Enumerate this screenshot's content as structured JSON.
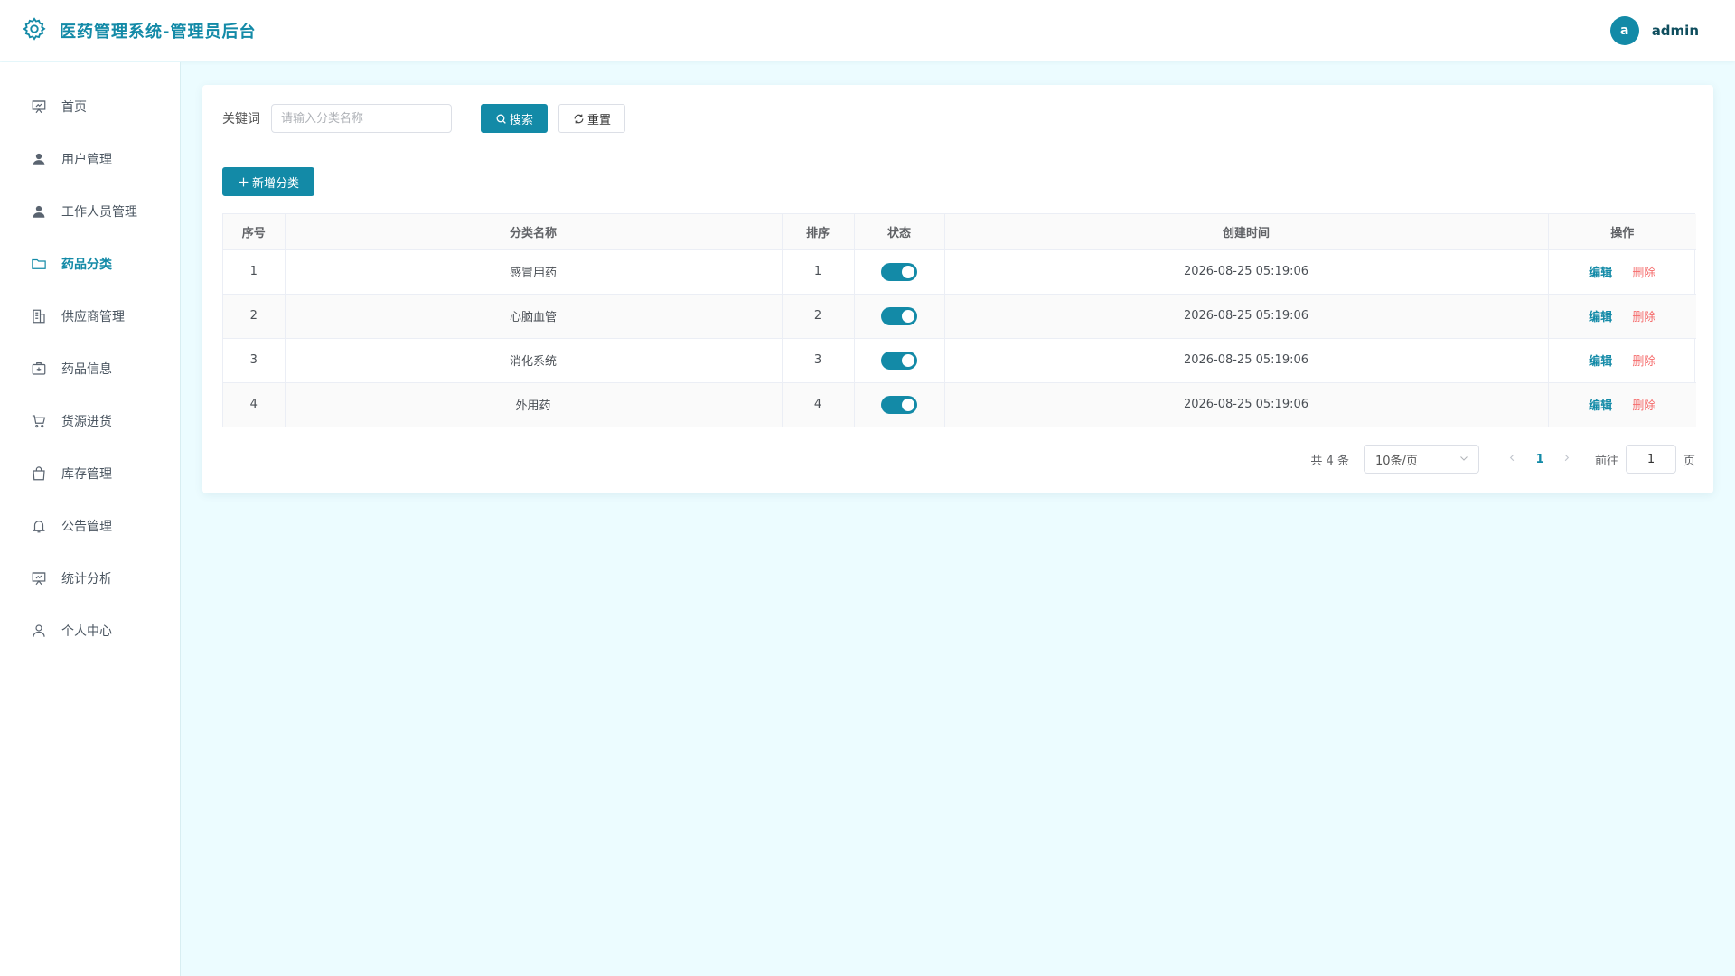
{
  "header": {
    "title": "医药管理系统-管理员后台",
    "avatar_letter": "a",
    "username": "admin"
  },
  "sidebar": {
    "items": [
      {
        "label": "首页",
        "icon": "presentation-icon"
      },
      {
        "label": "用户管理",
        "icon": "user-icon"
      },
      {
        "label": "工作人员管理",
        "icon": "user-icon"
      },
      {
        "label": "药品分类",
        "icon": "folder-icon",
        "active": true
      },
      {
        "label": "供应商管理",
        "icon": "building-icon"
      },
      {
        "label": "药品信息",
        "icon": "medicine-box-icon"
      },
      {
        "label": "货源进货",
        "icon": "cart-icon"
      },
      {
        "label": "库存管理",
        "icon": "shopping-bag-icon"
      },
      {
        "label": "公告管理",
        "icon": "bell-icon"
      },
      {
        "label": "统计分析",
        "icon": "presentation-icon"
      },
      {
        "label": "个人中心",
        "icon": "user-outline-icon"
      }
    ]
  },
  "search": {
    "label": "关键词",
    "placeholder": "请输入分类名称",
    "search_button": "搜索",
    "reset_button": "重置"
  },
  "add_button": "新增分类",
  "table": {
    "columns": [
      "序号",
      "分类名称",
      "排序",
      "状态",
      "创建时间",
      "操作"
    ],
    "rows": [
      {
        "index": "1",
        "name": "感冒用药",
        "sort": "1",
        "enabled": true,
        "created": "2026-08-25 05:19:06"
      },
      {
        "index": "2",
        "name": "心脑血管",
        "sort": "2",
        "enabled": true,
        "created": "2026-08-25 05:19:06"
      },
      {
        "index": "3",
        "name": "消化系统",
        "sort": "3",
        "enabled": true,
        "created": "2026-08-25 05:19:06"
      },
      {
        "index": "4",
        "name": "外用药",
        "sort": "4",
        "enabled": true,
        "created": "2026-08-25 05:19:06"
      }
    ],
    "edit_label": "编辑",
    "delete_label": "删除"
  },
  "pagination": {
    "total_text": "共 4 条",
    "page_size": "10条/页",
    "current_page": "1",
    "goto_prefix": "前往",
    "goto_value": "1",
    "goto_suffix": "页"
  },
  "colors": {
    "primary": "#138aa7",
    "danger": "#f56c6c",
    "background": "#ecfcff"
  }
}
